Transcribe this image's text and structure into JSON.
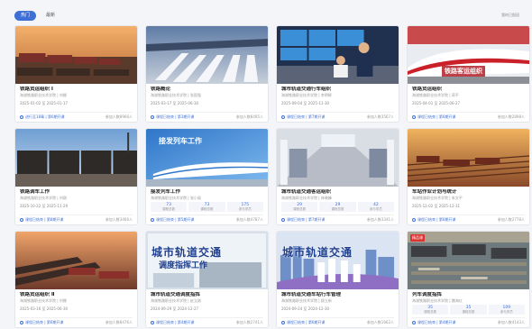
{
  "tabs": [
    {
      "label": "热门",
      "active": true
    },
    {
      "label": "最新",
      "active": false
    }
  ],
  "topbar_right": "我的已报班",
  "colors": {
    "accent": "#3d6fd6"
  },
  "cards": [
    {
      "title": "铁路货运组织 Ⅰ",
      "sub": "海湖铁路职业技术学院 | 刘娜",
      "date": "2025-01-02 至 2025-01-17",
      "link": "进行至18章 | 第6期开课",
      "count": "参加人数8966人",
      "thumb": "freight"
    },
    {
      "title": "铁路概论",
      "sub": "海湖铁路职业技术学院 | 张国强",
      "date": "2025-03-17 至 2025-06-30",
      "link": "课程已结束 | 第3期开课",
      "count": "参加人数8495人",
      "thumb": "station"
    },
    {
      "title": "城市轨道交通行车组织",
      "sub": "海湖铁路职业技术学院 | 李明辉",
      "date": "2025-09-04 至 2025-11-30",
      "link": "课程已结束 | 第7期开课",
      "count": "参加人数3567人",
      "thumb": "control"
    },
    {
      "title": "铁路货运组织",
      "sub": "海湖铁路职业技术学院 | 蒋平",
      "date": "2025-04-01 至 2025-06-27",
      "link": "课程已结束 | 第6期开课",
      "count": "参加人数2898人",
      "thumb": "hsr",
      "banner": "铁路客运组织"
    },
    {
      "title": "铁路调车工作",
      "sub": "海湖铁路职业技术学院 | 刘刚",
      "date": "2025-10-22 至 2025-11-29",
      "link": "课程已结束 | 第8期开课",
      "count": "参加人数3466人",
      "thumb": "wagons"
    },
    {
      "title": "接发列车工作",
      "sub": "海湖铁路职业技术学院 | 张小丽",
      "date": "",
      "stats": [
        {
          "n": "73",
          "l": "课程总数"
        },
        {
          "n": "73",
          "l": "课程总数"
        },
        {
          "n": "175",
          "l": "参与学员"
        }
      ],
      "link": "课程已结束 | 第5期开课",
      "count": "参加人数4787人",
      "thumb": "dispatch",
      "blue": "接发列车工作"
    },
    {
      "title": "城市轨道交通客运组织",
      "sub": "海湖铁路职业技术学院 | 林晓峰",
      "date": "",
      "stats": [
        {
          "n": "29",
          "l": "课程总数"
        },
        {
          "n": "29",
          "l": "课程总数"
        },
        {
          "n": "42",
          "l": "参与学员"
        }
      ],
      "link": "课程已结束 | 第7期开课",
      "count": "参加人数3341人",
      "thumb": "metro"
    },
    {
      "title": "车站作业计划与统计",
      "sub": "海湖铁路职业技术学院 | 朱文平",
      "date": "2025-12-02 至 2025-12-31",
      "link": "课程已结束 | 第6期开课",
      "count": "参加人数2778人",
      "thumb": "yard"
    },
    {
      "title": "铁路货运组织 Ⅱ",
      "sub": "海湖铁路职业技术学院 | 刘娜",
      "date": "2025-03-16 至 2025-06-30",
      "link": "课程已结束 | 第6期开课",
      "count": "参加人数8476人",
      "thumb": "freight2"
    },
    {
      "title": "城市轨道交通调度指挥",
      "sub": "海湖铁路职业技术学院 | 赵立刚",
      "date": "2024-09-29 至 2024-12-27",
      "link": "课程已结束 | 第4期开课",
      "count": "参加人数2741人",
      "thumb": "book",
      "overlay": "城市轨道交通",
      "overlay2": "调度指挥工作"
    },
    {
      "title": "城市轨道交通车站行车管理",
      "sub": "海湖铁路职业技术学院 | 顾立新",
      "date": "2024-09-24 至 2024-12-30",
      "link": "课程已结束 | 第6期开课",
      "count": "参加人数1662人",
      "thumb": "city",
      "overlay": "城市轨道交通"
    },
    {
      "title": "列车调度指挥",
      "sub": "海湖铁路职业技术学院 | 魏海红",
      "date": "",
      "stats": [
        {
          "n": "35",
          "l": "课程总数"
        },
        {
          "n": "35",
          "l": "课程总数"
        },
        {
          "n": "109",
          "l": "参与学员"
        }
      ],
      "link": "课程已结束 | 第4期开课",
      "count": "参加人数4143人",
      "thumb": "aerial",
      "tag": "精品课"
    }
  ]
}
